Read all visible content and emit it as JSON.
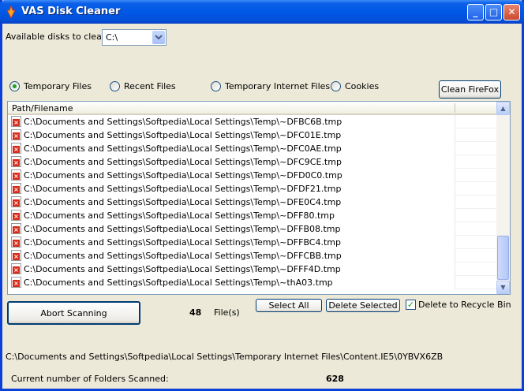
{
  "window": {
    "title": "VAS Disk Cleaner",
    "minimize": "_",
    "maximize": "□",
    "close": "✕"
  },
  "disks": {
    "label": "Available disks to clean:",
    "selected": "C:\\"
  },
  "modes": [
    {
      "label": "Temporary Files",
      "selected": true
    },
    {
      "label": "Recent Files",
      "selected": false
    },
    {
      "label": "Temporary Internet Files",
      "selected": false
    },
    {
      "label": "Cookies",
      "selected": false
    }
  ],
  "buttons": {
    "clean_firefox": "Clean FireFox",
    "abort": "Abort Scanning",
    "select_all": "Select All",
    "delete_selected": "Delete Selected"
  },
  "list": {
    "header": "Path/Filename",
    "rows": [
      "C:\\Documents and Settings\\Softpedia\\Local Settings\\Temp\\~DFBC6B.tmp",
      "C:\\Documents and Settings\\Softpedia\\Local Settings\\Temp\\~DFC01E.tmp",
      "C:\\Documents and Settings\\Softpedia\\Local Settings\\Temp\\~DFC0AE.tmp",
      "C:\\Documents and Settings\\Softpedia\\Local Settings\\Temp\\~DFC9CE.tmp",
      "C:\\Documents and Settings\\Softpedia\\Local Settings\\Temp\\~DFD0C0.tmp",
      "C:\\Documents and Settings\\Softpedia\\Local Settings\\Temp\\~DFDF21.tmp",
      "C:\\Documents and Settings\\Softpedia\\Local Settings\\Temp\\~DFE0C4.tmp",
      "C:\\Documents and Settings\\Softpedia\\Local Settings\\Temp\\~DFF80.tmp",
      "C:\\Documents and Settings\\Softpedia\\Local Settings\\Temp\\~DFFB08.tmp",
      "C:\\Documents and Settings\\Softpedia\\Local Settings\\Temp\\~DFFBC4.tmp",
      "C:\\Documents and Settings\\Softpedia\\Local Settings\\Temp\\~DFFCBB.tmp",
      "C:\\Documents and Settings\\Softpedia\\Local Settings\\Temp\\~DFFF4D.tmp",
      "C:\\Documents and Settings\\Softpedia\\Local Settings\\Temp\\~thA03.tmp"
    ]
  },
  "files": {
    "count": "48",
    "unit": "File(s)"
  },
  "recycle": {
    "label": "Delete to Recycle Bin",
    "checked": true
  },
  "current_path": "C:\\Documents and Settings\\Softpedia\\Local Settings\\Temporary Internet Files\\Content.IE5\\0YBVX6ZB",
  "folders": {
    "label": "Current number of Folders Scanned:",
    "value": "628"
  },
  "colors": {
    "titlebar": "#0058e6",
    "face": "#ece9d8",
    "accent_green": "#21a121"
  }
}
